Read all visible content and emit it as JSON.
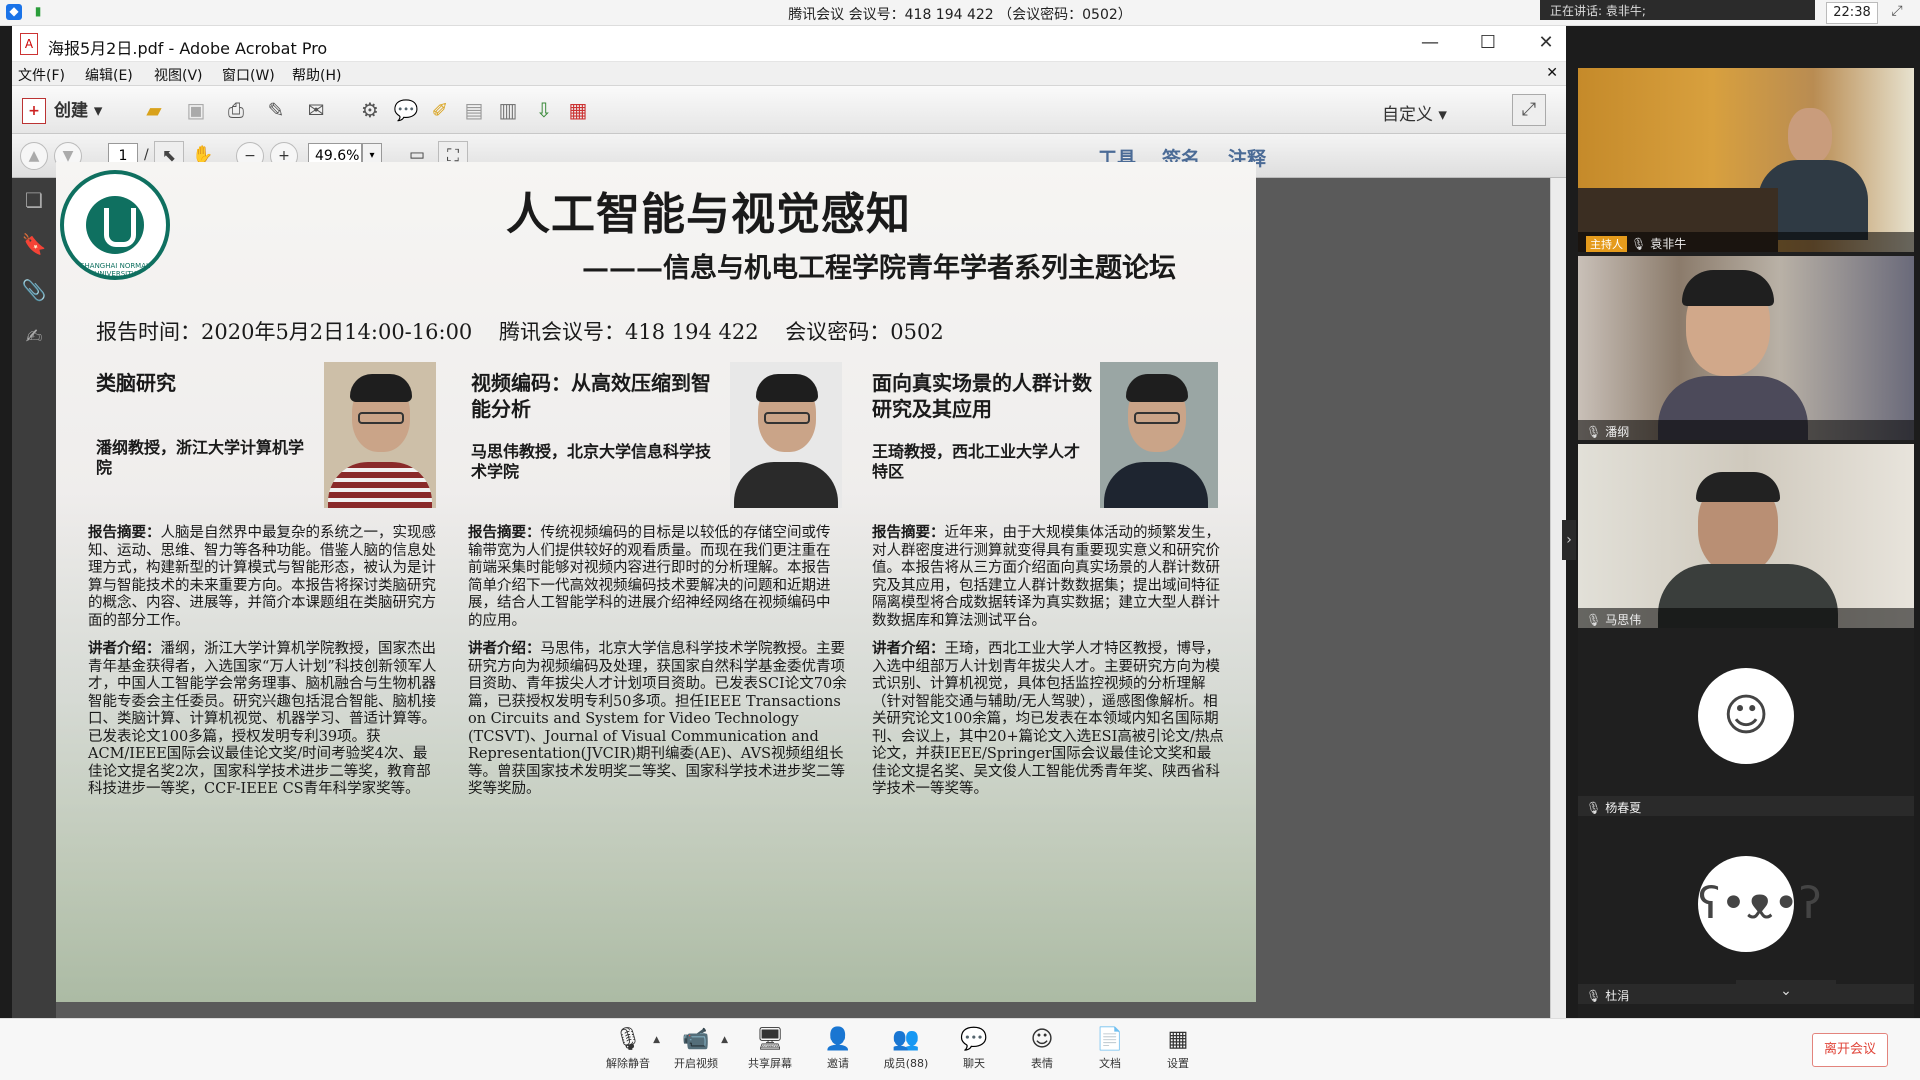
{
  "meeting": {
    "title": "腾讯会议 会议号：418 194 422 （会议密码：0502）",
    "speaking": "正在讲话: 袁非牛;",
    "clock": "22:38",
    "participants": [
      {
        "name": "袁非牛",
        "host_label": "主持人"
      },
      {
        "name": "潘纲"
      },
      {
        "name": "马思伟"
      },
      {
        "name": "杨春夏"
      },
      {
        "name": "杜涓"
      }
    ],
    "toolbar": [
      {
        "label": "解除静音",
        "icon": "mic-muted-icon"
      },
      {
        "label": "开启视频",
        "icon": "video-off-icon"
      },
      {
        "label": "共享屏幕",
        "icon": "share-screen-icon"
      },
      {
        "label": "邀请",
        "icon": "invite-icon"
      },
      {
        "label": "成员(88)",
        "icon": "members-icon"
      },
      {
        "label": "聊天",
        "icon": "chat-icon"
      },
      {
        "label": "表情",
        "icon": "emoji-icon"
      },
      {
        "label": "文档",
        "icon": "document-icon"
      },
      {
        "label": "设置",
        "icon": "settings-icon"
      }
    ],
    "leave_label": "离开会议"
  },
  "acrobat": {
    "title": "海报5月2日.pdf - Adobe Acrobat Pro",
    "menus": [
      "文件(F)",
      "编辑(E)",
      "视图(V)",
      "窗口(W)",
      "帮助(H)"
    ],
    "create_label": "创建",
    "custom_label": "自定义",
    "page_current": "1",
    "page_total": "/ 1",
    "zoom": "49.6%",
    "right_tabs": [
      "工具",
      "签名",
      "注释"
    ]
  },
  "poster": {
    "title": "人工智能与视觉感知",
    "subtitle": "———信息与机电工程学院青年学者系列主题论坛",
    "info": "报告时间：2020年5月2日14:00-16:00    腾讯会议号：418 194 422    会议密码：0502",
    "logo_text": "SHANGHAI NORMAL UNIVERSITY",
    "talks": [
      {
        "topic": "类脑研究",
        "speaker": "潘纲教授，浙江大学计算机学院",
        "abstract_label": "报告摘要：",
        "abstract": "人脑是自然界中最复杂的系统之一，实现感知、运动、思维、智力等各种功能。借鉴人脑的信息处理方式，构建新型的计算模式与智能形态，被认为是计算与智能技术的未来重要方向。本报告将探讨类脑研究的概念、内容、进展等，并简介本课题组在类脑研究方面的部分工作。",
        "bio_label": "讲者介绍：",
        "bio": "潘纲，浙江大学计算机学院教授，国家杰出青年基金获得者，入选国家“万人计划”科技创新领军人才，中国人工智能学会常务理事、脑机融合与生物机器智能专委会主任委员。研究兴趣包括混合智能、脑机接口、类脑计算、计算机视觉、机器学习、普适计算等。已发表论文100多篇，授权发明专利39项。获ACM/IEEE国际会议最佳论文奖/时间考验奖4次、最佳论文提名奖2次，国家科学技术进步二等奖，教育部科技进步一等奖，CCF-IEEE CS青年科学家奖等。"
      },
      {
        "topic": "视频编码：从高效压缩到智能分析",
        "speaker": "马思伟教授，北京大学信息科学技术学院",
        "abstract_label": "报告摘要：",
        "abstract": "传统视频编码的目标是以较低的存储空间或传输带宽为人们提供较好的观看质量。而现在我们更注重在前端采集时能够对视频内容进行即时的分析理解。本报告简单介绍下一代高效视频编码技术要解决的问题和近期进展，结合人工智能学科的进展介绍神经网络在视频编码中的应用。",
        "bio_label": "讲者介绍：",
        "bio": "马思伟，北京大学信息科学技术学院教授。主要研究方向为视频编码及处理，获国家自然科学基金委优青项目资助、青年拔尖人才计划项目资助。已发表SCI论文70余篇，已获授权发明专利50多项。担任IEEE Transactions on Circuits and System for Video Technology (TCSVT)、Journal of Visual Communication and Representation(JVCIR)期刊编委(AE)、AVS视频组组长等。曾获国家技术发明奖二等奖、国家科学技术进步奖二等奖等奖励。"
      },
      {
        "topic": "面向真实场景的人群计数研究及其应用",
        "speaker": "王琦教授，西北工业大学人才特区",
        "abstract_label": "报告摘要：",
        "abstract": "近年来，由于大规模集体活动的频繁发生，对人群密度进行测算就变得具有重要现实意义和研究价值。本报告将从三方面介绍面向真实场景的人群计数研究及其应用，包括建立人群计数数据集；提出域间特征隔离模型将合成数据转译为真实数据；建立大型人群计数数据库和算法测试平台。",
        "bio_label": "讲者介绍：",
        "bio": "王琦，西北工业大学人才特区教授，博导，入选中组部万人计划青年拔尖人才。主要研究方向为模式识别、计算机视觉，具体包括监控视频的分析理解（针对智能交通与辅助/无人驾驶），遥感图像解析。相关研究论文100余篇，均已发表在本领域内知名国际期刊、会议上，其中20+篇论文入选ESI高被引论文/热点论文，并获IEEE/Springer国际会议最佳论文奖和最佳论文提名奖、吴文俊人工智能优秀青年奖、陕西省科学技术一等奖等。"
      }
    ]
  }
}
